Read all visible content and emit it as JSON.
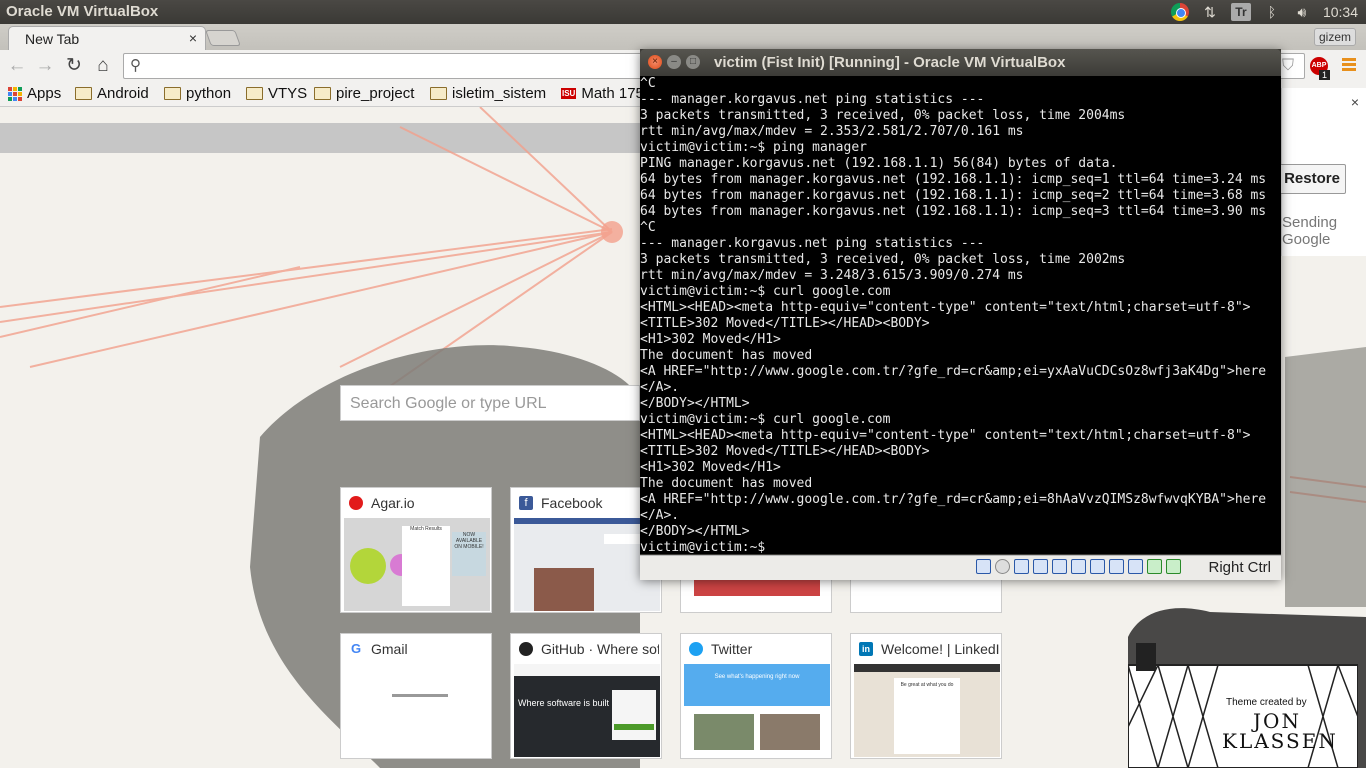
{
  "panel": {
    "app_title": "Oracle VM VirtualBox",
    "clock": "10:34",
    "tray_icons": [
      "chrome-icon",
      "network-arrows-icon",
      "translate-icon",
      "bluetooth-icon",
      "volume-icon"
    ],
    "translate_label": "Tr"
  },
  "browser": {
    "tab_title": "New Tab",
    "tab_close": "×",
    "profile_name": "gizem",
    "omnibox_value": "",
    "abp_label": "ABP",
    "abp_count": "1",
    "bookmarks": [
      {
        "label": "Apps",
        "icon": "apps-grid-icon"
      },
      {
        "label": "Android",
        "icon": "folder-icon"
      },
      {
        "label": "python",
        "icon": "folder-icon"
      },
      {
        "label": "VTYS",
        "icon": "folder-icon"
      },
      {
        "label": "pire_project",
        "icon": "folder-icon"
      },
      {
        "label": "isletim_sistem",
        "icon": "folder-icon"
      },
      {
        "label": "Math 175",
        "icon": "isu-icon",
        "icon_text": "ISU"
      }
    ]
  },
  "ntp": {
    "search_placeholder": "Search Google or type URL",
    "tiles": [
      {
        "title": "Agar.io",
        "favicon_color": "#e21b1b"
      },
      {
        "title": "Facebook",
        "favicon_color": "#3b5998",
        "favicon_text": "f"
      },
      {
        "title": "",
        "favicon_color": ""
      },
      {
        "title": "",
        "favicon_color": ""
      },
      {
        "title": "Gmail",
        "favicon_text": "G",
        "favicon_color": "#4285f4"
      },
      {
        "title": "GitHub · Where software is built",
        "favicon_color": "#222"
      },
      {
        "title": "Twitter",
        "favicon_color": "#1da1f2"
      },
      {
        "title": "Welcome! | LinkedIn",
        "favicon_color": "#0077b5",
        "favicon_text": "in"
      }
    ],
    "thumb_texts": {
      "agar_match": "Match Results",
      "agar_mobile": "NOW AVAILABLE ON MOBILE!",
      "github_headline": "Where software is built",
      "linkedin_headline": "Be great at what you do",
      "twitter_headline": "See what's happening right now"
    },
    "theme_credit_label": "Theme created by",
    "theme_credit_name": "JON KLASSEN",
    "restore": {
      "button": "Restore",
      "line1": "Sending",
      "line2": "Google",
      "close": "×"
    }
  },
  "vbox": {
    "title": "victim (Fist Init) [Running] - Oracle VM VirtualBox",
    "host_key": "Right Ctrl",
    "console_lines": [
      "^C",
      "--- manager.korgavus.net ping statistics ---",
      "3 packets transmitted, 3 received, 0% packet loss, time 2004ms",
      "rtt min/avg/max/mdev = 2.353/2.581/2.707/0.161 ms",
      "victim@victim:~$ ping manager",
      "PING manager.korgavus.net (192.168.1.1) 56(84) bytes of data.",
      "64 bytes from manager.korgavus.net (192.168.1.1): icmp_seq=1 ttl=64 time=3.24 ms",
      "64 bytes from manager.korgavus.net (192.168.1.1): icmp_seq=2 ttl=64 time=3.68 ms",
      "64 bytes from manager.korgavus.net (192.168.1.1): icmp_seq=3 ttl=64 time=3.90 ms",
      "^C",
      "--- manager.korgavus.net ping statistics ---",
      "3 packets transmitted, 3 received, 0% packet loss, time 2002ms",
      "rtt min/avg/max/mdev = 3.248/3.615/3.909/0.274 ms",
      "victim@victim:~$ curl google.com",
      "<HTML><HEAD><meta http-equiv=\"content-type\" content=\"text/html;charset=utf-8\">",
      "<TITLE>302 Moved</TITLE></HEAD><BODY>",
      "<H1>302 Moved</H1>",
      "The document has moved",
      "<A HREF=\"http://www.google.com.tr/?gfe_rd=cr&amp;ei=yxAaVuCDCsOz8wfj3aK4Dg\">here",
      "</A>.",
      "</BODY></HTML>",
      "victim@victim:~$ curl google.com",
      "<HTML><HEAD><meta http-equiv=\"content-type\" content=\"text/html;charset=utf-8\">",
      "<TITLE>302 Moved</TITLE></HEAD><BODY>",
      "<H1>302 Moved</H1>",
      "The document has moved",
      "<A HREF=\"http://www.google.com.tr/?gfe_rd=cr&amp;ei=8hAaVvzQIMSz8wfwvqKYBA\">here",
      "</A>.",
      "</BODY></HTML>",
      "victim@victim:~$"
    ]
  }
}
